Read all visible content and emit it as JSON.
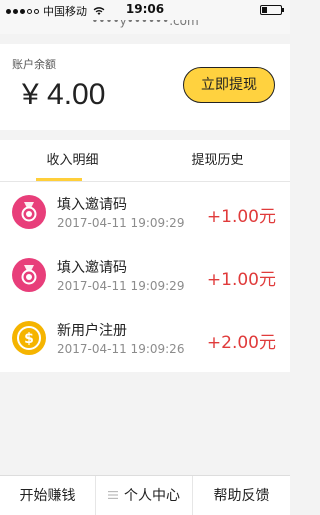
{
  "status_bar": {
    "carrier": "中国移动",
    "time": "19:06",
    "url_fragment": "••••y••••••.com"
  },
  "balance": {
    "label": "账户余额",
    "amount": "¥ 4.00",
    "withdraw_button": "立即提现"
  },
  "tabs": [
    {
      "label": "收入明细",
      "active": true
    },
    {
      "label": "提现历史",
      "active": false
    }
  ],
  "records": [
    {
      "title": "填入邀请码",
      "time": "2017-04-11 19:09:29",
      "amount": "+1.00元",
      "icon": "medal-icon"
    },
    {
      "title": "填入邀请码",
      "time": "2017-04-11 19:09:29",
      "amount": "+1.00元",
      "icon": "medal-icon"
    },
    {
      "title": "新用户注册",
      "time": "2017-04-11 19:09:26",
      "amount": "+2.00元",
      "icon": "coin-icon"
    }
  ],
  "bottom_nav": [
    {
      "label": "开始赚钱"
    },
    {
      "label": "个人中心"
    },
    {
      "label": "帮助反馈"
    }
  ],
  "colors": {
    "accent_yellow": "#ffd23f",
    "amount_red": "#e03b3b",
    "medal_pink": "#e83e7a",
    "coin_gold": "#f5b400"
  }
}
